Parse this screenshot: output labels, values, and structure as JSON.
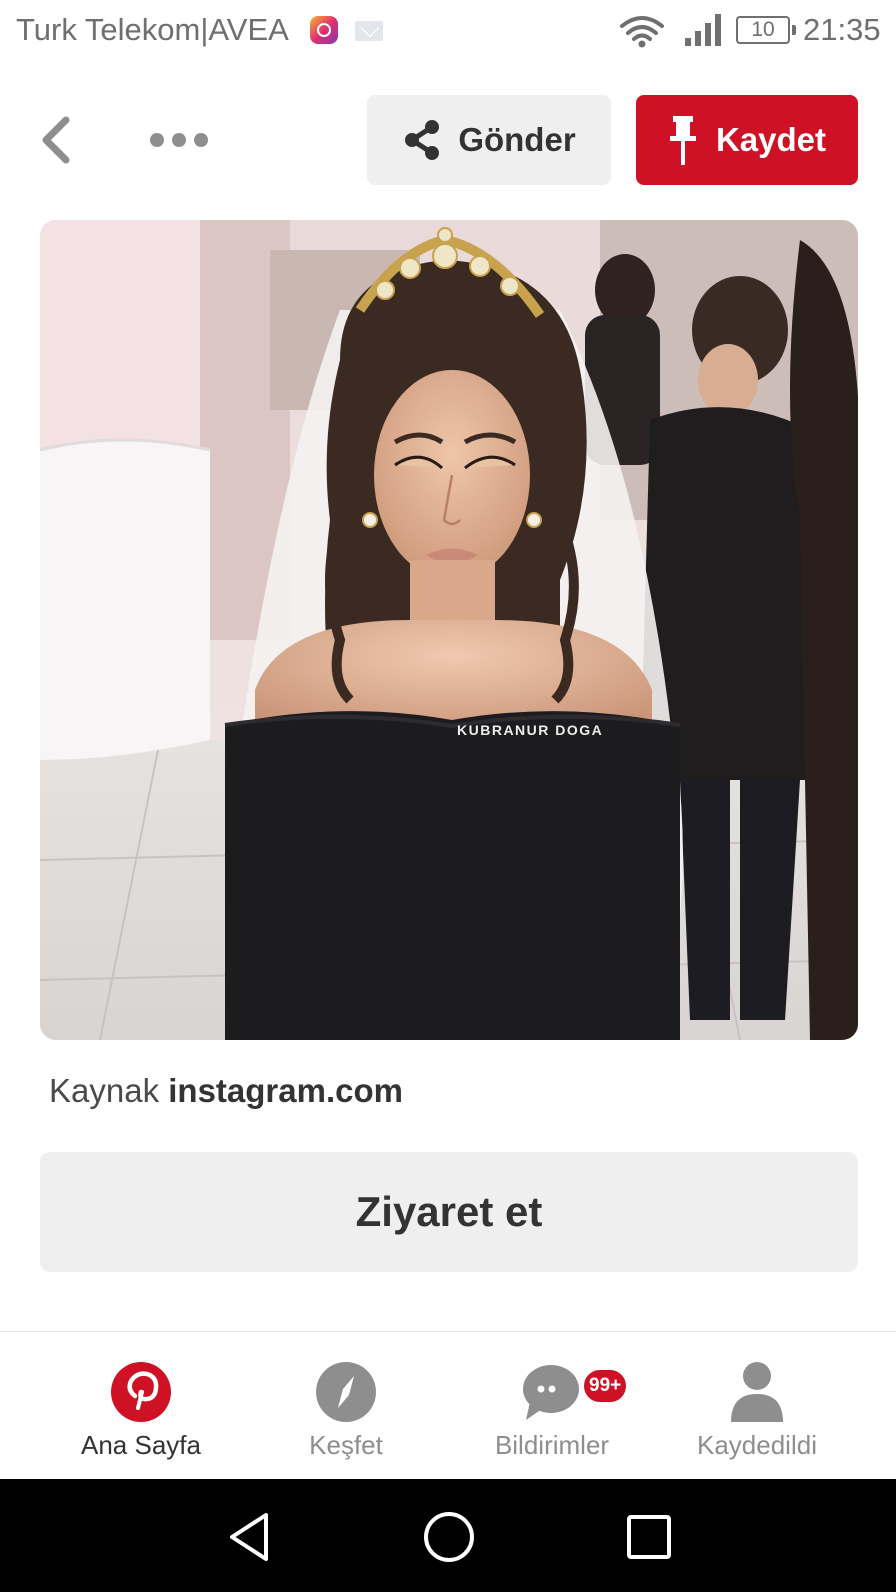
{
  "status_bar": {
    "carrier": "Turk Telekom|AVEA",
    "battery": "10",
    "time": "21:35",
    "icons": [
      "instagram-icon",
      "mail-icon",
      "wifi-icon",
      "signal-icon",
      "battery-icon"
    ]
  },
  "toolbar": {
    "back_icon": "chevron-left-icon",
    "more_icon": "ellipsis-icon",
    "send_label": "Gönder",
    "send_icon": "share-icon",
    "save_label": "Kaydet",
    "save_icon": "pin-icon",
    "save_color": "#cf1126"
  },
  "pin": {
    "watermark": "KUBRANUR DOGA"
  },
  "source": {
    "prefix": "Kaynak",
    "domain": "instagram.com"
  },
  "visit": {
    "label": "Ziyaret et"
  },
  "tabbar": {
    "tabs": [
      {
        "label": "Ana Sayfa",
        "icon": "pinterest-logo-icon",
        "active": true
      },
      {
        "label": "Keşfet",
        "icon": "compass-icon",
        "active": false
      },
      {
        "label": "Bildirimler",
        "icon": "chat-bubble-icon",
        "active": false,
        "badge": "99+"
      },
      {
        "label": "Kaydedildi",
        "icon": "profile-icon",
        "active": false
      }
    ]
  },
  "navbar": {
    "buttons": [
      "back-triangle-icon",
      "home-circle-icon",
      "recents-square-icon"
    ]
  }
}
